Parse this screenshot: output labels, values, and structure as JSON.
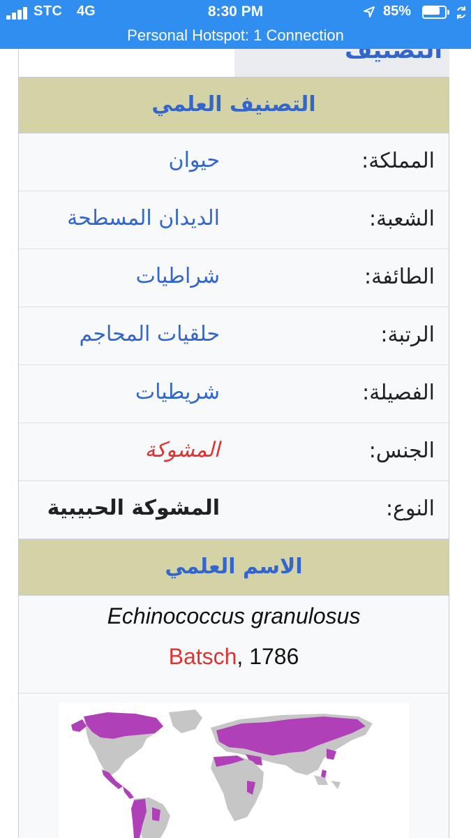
{
  "status_bar": {
    "carrier": "STC",
    "network": "4G",
    "time": "8:30 PM",
    "battery_percent": "85%",
    "battery_level": 0.85,
    "hotspot": "Personal Hotspot: 1 Connection",
    "bar_color": "#2f8ef0"
  },
  "infobox": {
    "partial_heading": "التصنيف",
    "taxonomy_header": "التصنيف العلمي",
    "rows": [
      {
        "label": "المملكة:",
        "value": "حيوان"
      },
      {
        "label": "الشعبة:",
        "value": "الديدان المسطحة"
      },
      {
        "label": "الطائفة:",
        "value": "شراطيات"
      },
      {
        "label": "الرتبة:",
        "value": "حلقيات المحاجم"
      },
      {
        "label": "الفصيلة:",
        "value": "شريطيات"
      },
      {
        "label": "الجنس:",
        "value": "المشوكة"
      },
      {
        "label": "النوع:",
        "value": "المشوكة الحبيبية"
      }
    ],
    "scientific_name_header": "الاسم العلمي",
    "binomial": "Echinococcus granulosus",
    "author": "Batsch",
    "author_year": ", 1786",
    "header_color": "#d3d3a5",
    "link_color": "#3366cc",
    "missing_link_color": "#dd3333",
    "map_highlight_color": "#b040b8",
    "map_land_color": "#c6c6c6"
  }
}
